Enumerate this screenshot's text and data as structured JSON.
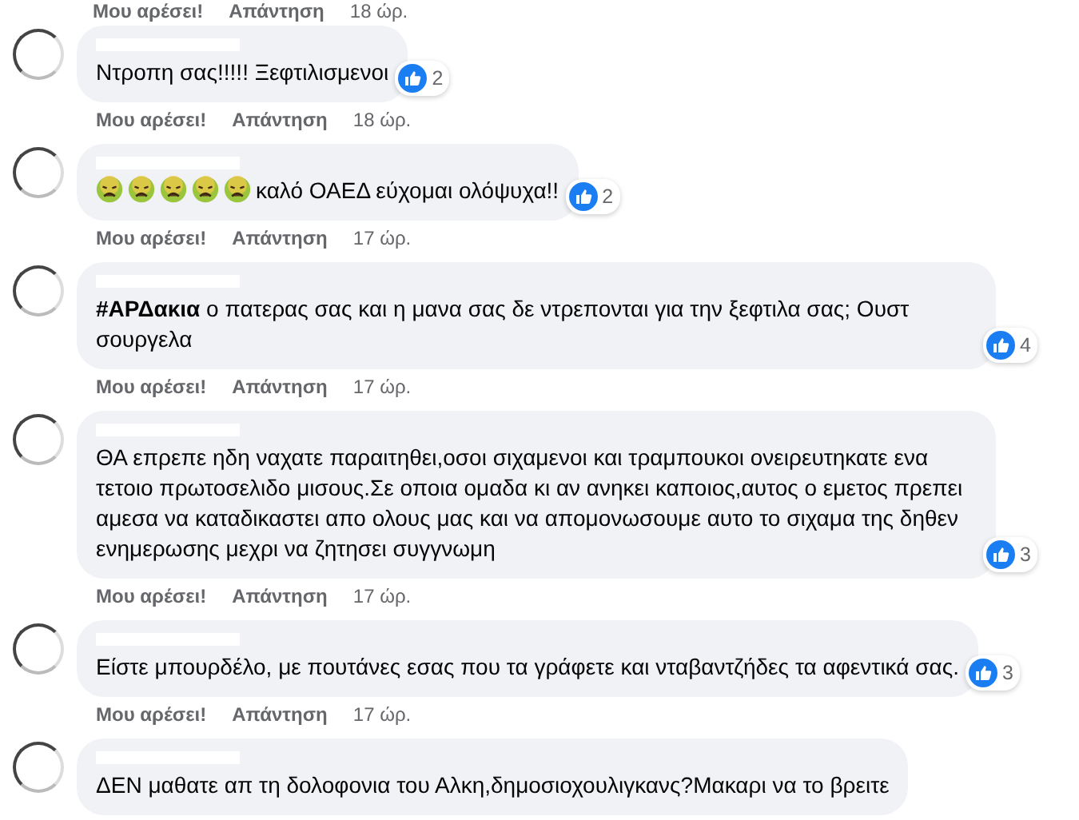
{
  "top_actions": {
    "like": "Μου αρέσει!",
    "reply": "Απάντηση",
    "time": "18 ώρ."
  },
  "comments": [
    {
      "text": "Ντροπη σας!!!!! Ξεφτιλισμενοι",
      "reactions": "2",
      "like": "Μου αρέσει!",
      "reply": "Απάντηση",
      "time": "18 ώρ."
    },
    {
      "emojis": [
        {
          "kind": "nauseated"
        },
        {
          "kind": "nauseated"
        },
        {
          "kind": "nauseated"
        },
        {
          "kind": "nauseated"
        },
        {
          "kind": "nauseated"
        }
      ],
      "text": "καλό ΟΑΕΔ εύχομαι ολόψυχα!!",
      "reactions": "2",
      "like": "Μου αρέσει!",
      "reply": "Απάντηση",
      "time": "17 ώρ."
    },
    {
      "text": "**#ΑΡΔακια** ο πατερας σας και η μανα σας δε ντρεπονται για την ξεφτιλα σας; Ουστ σουργελα",
      "reactions": "4",
      "like": "Μου αρέσει!",
      "reply": "Απάντηση",
      "time": "17 ώρ."
    },
    {
      "text": "ΘΑ επρεπε ηδη ναχατε παραιτηθει,οσοι σιχαμενοι και τραμπουκοι ονειρευτηκατε ενα τετοιο πρωτοσελιδο μισους.Σε οποια ομαδα κι αν ανηκει καποιος,αυτος ο εμετος πρεπει αμεσα να καταδικαστει απο ολους μας και να απομονωσουμε αυτο το σιχαμα της δηθεν ενημερωσης μεχρι να ζητησει συγγνωμη",
      "reactions": "3",
      "like": "Μου αρέσει!",
      "reply": "Απάντηση",
      "time": "17 ώρ."
    },
    {
      "text": "Είστε μπουρδέλο, με πουτάνες εσας που τα γράφετε και νταβαντζήδες τα αφεντικά σας.",
      "reactions": "3",
      "like": "Μου αρέσει!",
      "reply": "Απάντηση",
      "time": "17 ώρ."
    },
    {
      "text": "ΔΕΝ μαθατε απ τη δολοφονια του Αλκη,δημοσιοχουλιγκανς?Μακαρι να το βρειτε"
    }
  ]
}
